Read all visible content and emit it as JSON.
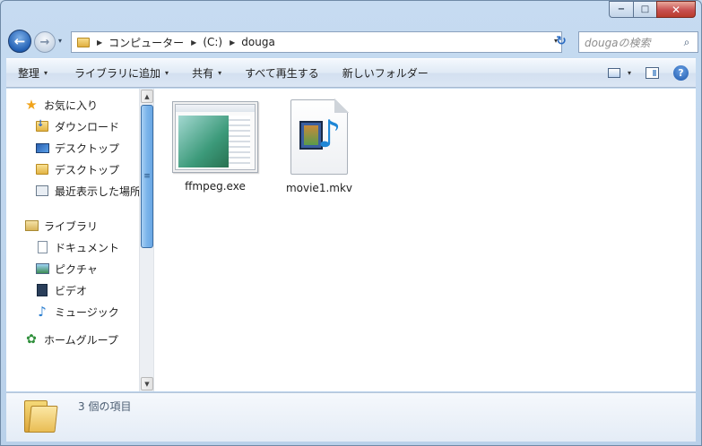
{
  "window": {
    "caption": {
      "minimize": "−",
      "maximize": "□",
      "close": "✕"
    }
  },
  "nav": {
    "back_glyph": "←",
    "forward_glyph": "→",
    "history_glyph": "▾",
    "breadcrumb": [
      {
        "label": "コンピューター"
      },
      {
        "label": "(C:)"
      },
      {
        "label": "douga"
      }
    ],
    "address_dropdown_glyph": "▾",
    "refresh_glyph": "↻",
    "search": {
      "placeholder": "dougaの検索",
      "icon_glyph": "⌕"
    }
  },
  "commandbar": {
    "organize": "整理",
    "add_to_library": "ライブラリに追加",
    "share": "共有",
    "play_all": "すべて再生する",
    "new_folder": "新しいフォルダー",
    "dropdown_glyph": "▾",
    "help_glyph": "?"
  },
  "sidebar": {
    "favorites": {
      "label": "お気に入り",
      "items": [
        {
          "label": "ダウンロード",
          "icon": "download-folder-icon"
        },
        {
          "label": "デスクトップ",
          "icon": "desktop-icon"
        },
        {
          "label": "デスクトップ",
          "icon": "folder-icon"
        },
        {
          "label": "最近表示した場所",
          "icon": "recent-places-icon"
        }
      ]
    },
    "libraries": {
      "label": "ライブラリ",
      "items": [
        {
          "label": "ドキュメント",
          "icon": "documents-icon"
        },
        {
          "label": "ピクチャ",
          "icon": "pictures-icon"
        },
        {
          "label": "ビデオ",
          "icon": "videos-icon"
        },
        {
          "label": "ミュージック",
          "icon": "music-icon"
        }
      ]
    },
    "homegroup": {
      "label": "ホームグループ"
    },
    "scroll": {
      "up_glyph": "▲",
      "down_glyph": "▼",
      "grip_glyph": "≡"
    }
  },
  "files": [
    {
      "name": "ffmpeg.exe",
      "icon": "exe-thumbnail-icon"
    },
    {
      "name": "movie1.mkv",
      "icon": "media-file-icon"
    }
  ],
  "details": {
    "item_count": "3 個の項目"
  }
}
